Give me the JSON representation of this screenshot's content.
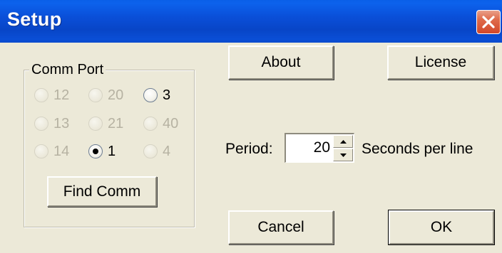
{
  "window": {
    "title": "Setup",
    "close_icon": "close-icon",
    "close_color": "#d9512f",
    "titlebar_color": "#0a4ed6"
  },
  "comm_port": {
    "group_label": "Comm Port",
    "options": [
      {
        "label": "12",
        "enabled": false,
        "selected": false
      },
      {
        "label": "20",
        "enabled": false,
        "selected": false
      },
      {
        "label": "3",
        "enabled": true,
        "selected": false
      },
      {
        "label": "13",
        "enabled": false,
        "selected": false
      },
      {
        "label": "21",
        "enabled": false,
        "selected": false
      },
      {
        "label": "40",
        "enabled": false,
        "selected": false
      },
      {
        "label": "14",
        "enabled": false,
        "selected": false
      },
      {
        "label": "1",
        "enabled": true,
        "selected": true
      },
      {
        "label": "4",
        "enabled": false,
        "selected": false
      }
    ],
    "find_label": "Find Comm"
  },
  "buttons": {
    "about": "About",
    "license": "License",
    "cancel": "Cancel",
    "ok": "OK"
  },
  "period": {
    "label": "Period:",
    "value": "20",
    "suffix": "Seconds per line"
  }
}
